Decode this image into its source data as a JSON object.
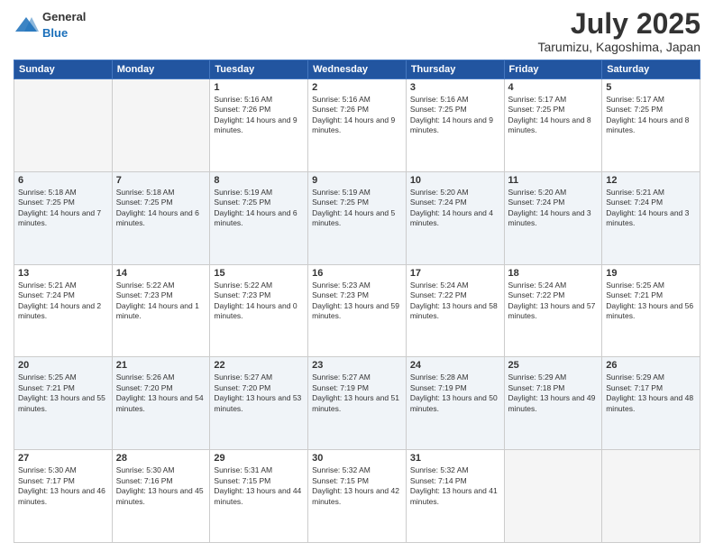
{
  "header": {
    "logo_general": "General",
    "logo_blue": "Blue",
    "month_year": "July 2025",
    "location": "Tarumizu, Kagoshima, Japan"
  },
  "weekdays": [
    "Sunday",
    "Monday",
    "Tuesday",
    "Wednesday",
    "Thursday",
    "Friday",
    "Saturday"
  ],
  "weeks": [
    [
      {
        "day": "",
        "info": ""
      },
      {
        "day": "",
        "info": ""
      },
      {
        "day": "1",
        "info": "Sunrise: 5:16 AM\nSunset: 7:26 PM\nDaylight: 14 hours and 9 minutes."
      },
      {
        "day": "2",
        "info": "Sunrise: 5:16 AM\nSunset: 7:26 PM\nDaylight: 14 hours and 9 minutes."
      },
      {
        "day": "3",
        "info": "Sunrise: 5:16 AM\nSunset: 7:25 PM\nDaylight: 14 hours and 9 minutes."
      },
      {
        "day": "4",
        "info": "Sunrise: 5:17 AM\nSunset: 7:25 PM\nDaylight: 14 hours and 8 minutes."
      },
      {
        "day": "5",
        "info": "Sunrise: 5:17 AM\nSunset: 7:25 PM\nDaylight: 14 hours and 8 minutes."
      }
    ],
    [
      {
        "day": "6",
        "info": "Sunrise: 5:18 AM\nSunset: 7:25 PM\nDaylight: 14 hours and 7 minutes."
      },
      {
        "day": "7",
        "info": "Sunrise: 5:18 AM\nSunset: 7:25 PM\nDaylight: 14 hours and 6 minutes."
      },
      {
        "day": "8",
        "info": "Sunrise: 5:19 AM\nSunset: 7:25 PM\nDaylight: 14 hours and 6 minutes."
      },
      {
        "day": "9",
        "info": "Sunrise: 5:19 AM\nSunset: 7:25 PM\nDaylight: 14 hours and 5 minutes."
      },
      {
        "day": "10",
        "info": "Sunrise: 5:20 AM\nSunset: 7:24 PM\nDaylight: 14 hours and 4 minutes."
      },
      {
        "day": "11",
        "info": "Sunrise: 5:20 AM\nSunset: 7:24 PM\nDaylight: 14 hours and 3 minutes."
      },
      {
        "day": "12",
        "info": "Sunrise: 5:21 AM\nSunset: 7:24 PM\nDaylight: 14 hours and 3 minutes."
      }
    ],
    [
      {
        "day": "13",
        "info": "Sunrise: 5:21 AM\nSunset: 7:24 PM\nDaylight: 14 hours and 2 minutes."
      },
      {
        "day": "14",
        "info": "Sunrise: 5:22 AM\nSunset: 7:23 PM\nDaylight: 14 hours and 1 minute."
      },
      {
        "day": "15",
        "info": "Sunrise: 5:22 AM\nSunset: 7:23 PM\nDaylight: 14 hours and 0 minutes."
      },
      {
        "day": "16",
        "info": "Sunrise: 5:23 AM\nSunset: 7:23 PM\nDaylight: 13 hours and 59 minutes."
      },
      {
        "day": "17",
        "info": "Sunrise: 5:24 AM\nSunset: 7:22 PM\nDaylight: 13 hours and 58 minutes."
      },
      {
        "day": "18",
        "info": "Sunrise: 5:24 AM\nSunset: 7:22 PM\nDaylight: 13 hours and 57 minutes."
      },
      {
        "day": "19",
        "info": "Sunrise: 5:25 AM\nSunset: 7:21 PM\nDaylight: 13 hours and 56 minutes."
      }
    ],
    [
      {
        "day": "20",
        "info": "Sunrise: 5:25 AM\nSunset: 7:21 PM\nDaylight: 13 hours and 55 minutes."
      },
      {
        "day": "21",
        "info": "Sunrise: 5:26 AM\nSunset: 7:20 PM\nDaylight: 13 hours and 54 minutes."
      },
      {
        "day": "22",
        "info": "Sunrise: 5:27 AM\nSunset: 7:20 PM\nDaylight: 13 hours and 53 minutes."
      },
      {
        "day": "23",
        "info": "Sunrise: 5:27 AM\nSunset: 7:19 PM\nDaylight: 13 hours and 51 minutes."
      },
      {
        "day": "24",
        "info": "Sunrise: 5:28 AM\nSunset: 7:19 PM\nDaylight: 13 hours and 50 minutes."
      },
      {
        "day": "25",
        "info": "Sunrise: 5:29 AM\nSunset: 7:18 PM\nDaylight: 13 hours and 49 minutes."
      },
      {
        "day": "26",
        "info": "Sunrise: 5:29 AM\nSunset: 7:17 PM\nDaylight: 13 hours and 48 minutes."
      }
    ],
    [
      {
        "day": "27",
        "info": "Sunrise: 5:30 AM\nSunset: 7:17 PM\nDaylight: 13 hours and 46 minutes."
      },
      {
        "day": "28",
        "info": "Sunrise: 5:30 AM\nSunset: 7:16 PM\nDaylight: 13 hours and 45 minutes."
      },
      {
        "day": "29",
        "info": "Sunrise: 5:31 AM\nSunset: 7:15 PM\nDaylight: 13 hours and 44 minutes."
      },
      {
        "day": "30",
        "info": "Sunrise: 5:32 AM\nSunset: 7:15 PM\nDaylight: 13 hours and 42 minutes."
      },
      {
        "day": "31",
        "info": "Sunrise: 5:32 AM\nSunset: 7:14 PM\nDaylight: 13 hours and 41 minutes."
      },
      {
        "day": "",
        "info": ""
      },
      {
        "day": "",
        "info": ""
      }
    ]
  ]
}
